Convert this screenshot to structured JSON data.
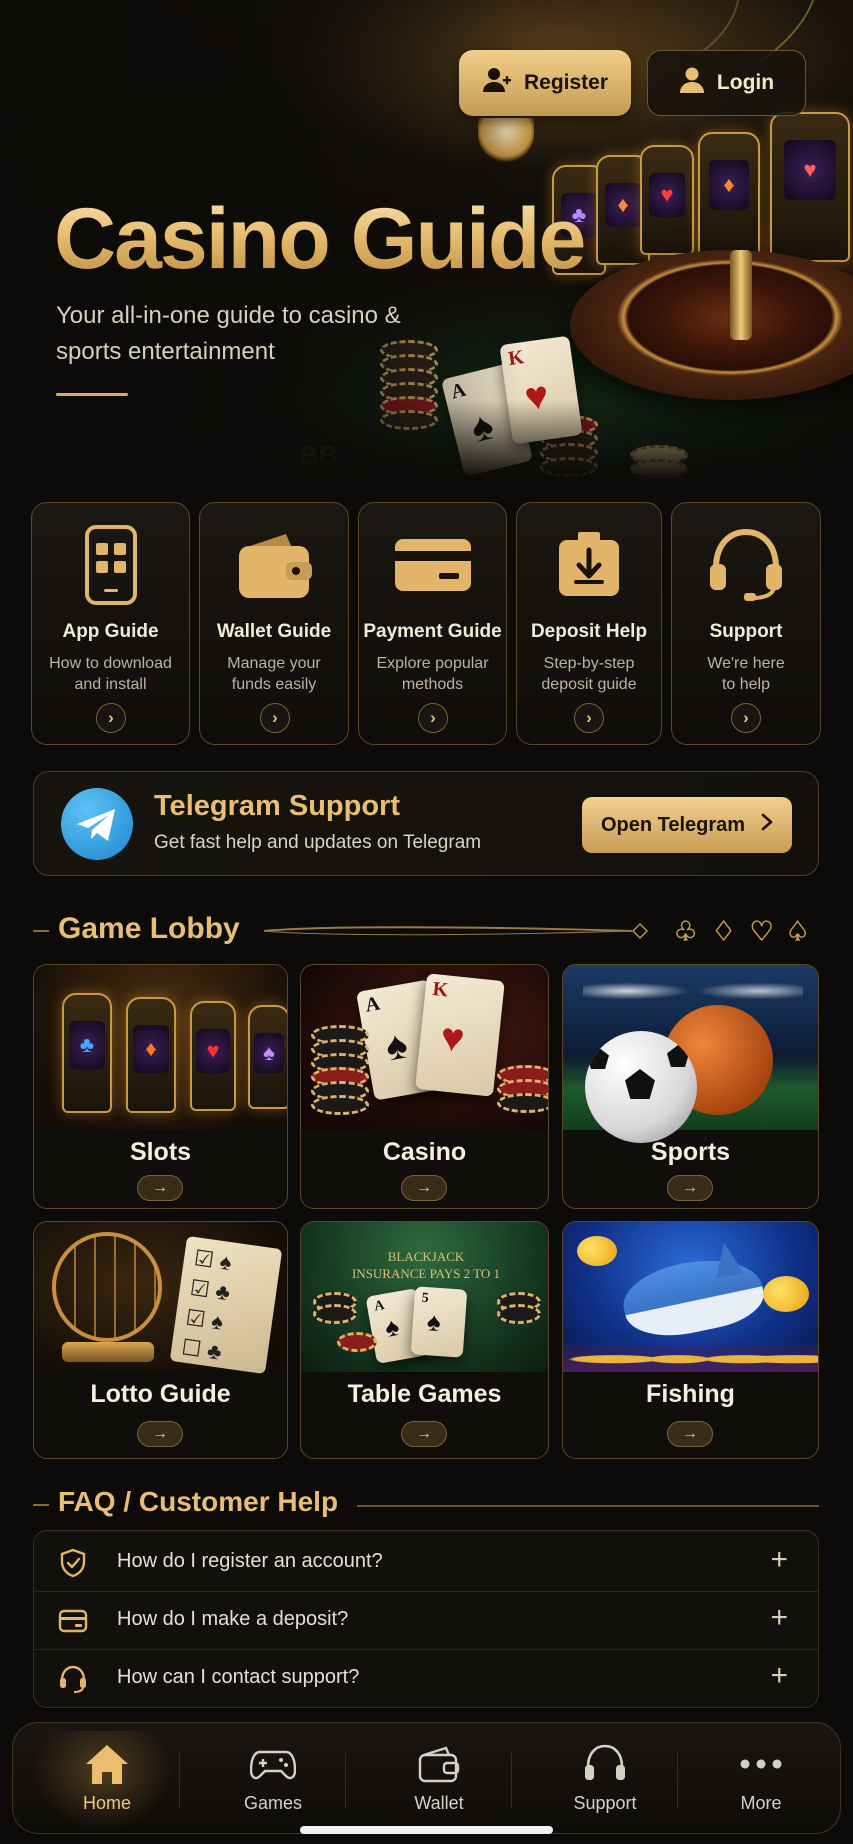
{
  "header": {
    "register_label": "Register",
    "login_label": "Login"
  },
  "hero": {
    "title": "Casino Guide",
    "subtitle": "Your all-in-one guide to casino & sports entertainment"
  },
  "guides": [
    {
      "title": "App Guide",
      "desc_line1": "How to download",
      "desc_line2": "and install",
      "icon": "phone-app-icon"
    },
    {
      "title": "Wallet Guide",
      "desc_line1": "Manage your",
      "desc_line2": "funds easily",
      "icon": "wallet-icon"
    },
    {
      "title": "Payment Guide",
      "desc_line1": "Explore popular",
      "desc_line2": "methods",
      "icon": "credit-card-icon"
    },
    {
      "title": "Deposit Help",
      "desc_line1": "Step-by-step",
      "desc_line2": "deposit guide",
      "icon": "deposit-box-icon"
    },
    {
      "title": "Support",
      "desc_line1": "We're here",
      "desc_line2": "to help",
      "icon": "headset-icon"
    }
  ],
  "telegram": {
    "title": "Telegram Support",
    "subtitle": "Get fast help and updates on Telegram",
    "button_label": "Open Telegram"
  },
  "lobby": {
    "title": "Game Lobby",
    "games": [
      {
        "label": "Slots"
      },
      {
        "label": "Casino"
      },
      {
        "label": "Sports"
      },
      {
        "label": "Lotto Guide"
      },
      {
        "label": "Table Games"
      },
      {
        "label": "Fishing"
      }
    ]
  },
  "faq": {
    "title": "FAQ / Customer Help",
    "items": [
      {
        "question": "How do I register an account?",
        "icon": "shield-check-icon"
      },
      {
        "question": "How do I make a deposit?",
        "icon": "card-icon"
      },
      {
        "question": "How can I contact support?",
        "icon": "headset-icon"
      }
    ]
  },
  "nav": {
    "items": [
      {
        "label": "Home",
        "icon": "home-icon",
        "active": true
      },
      {
        "label": "Games",
        "icon": "gamepad-icon"
      },
      {
        "label": "Wallet",
        "icon": "wallet-icon"
      },
      {
        "label": "Support",
        "icon": "headset-icon"
      },
      {
        "label": "More",
        "icon": "more-dots-icon"
      }
    ]
  },
  "colors": {
    "accent_gold": "#e8bf72",
    "background": "#0c0b09",
    "telegram_blue": "#2a9be0"
  },
  "hero_art": {
    "felt_marking": "BB",
    "card_ranks": [
      "A",
      "K"
    ]
  },
  "table_art": {
    "felt_line1": "BLACKJACK",
    "felt_line2": "INSURANCE PAYS 2 TO 1"
  }
}
